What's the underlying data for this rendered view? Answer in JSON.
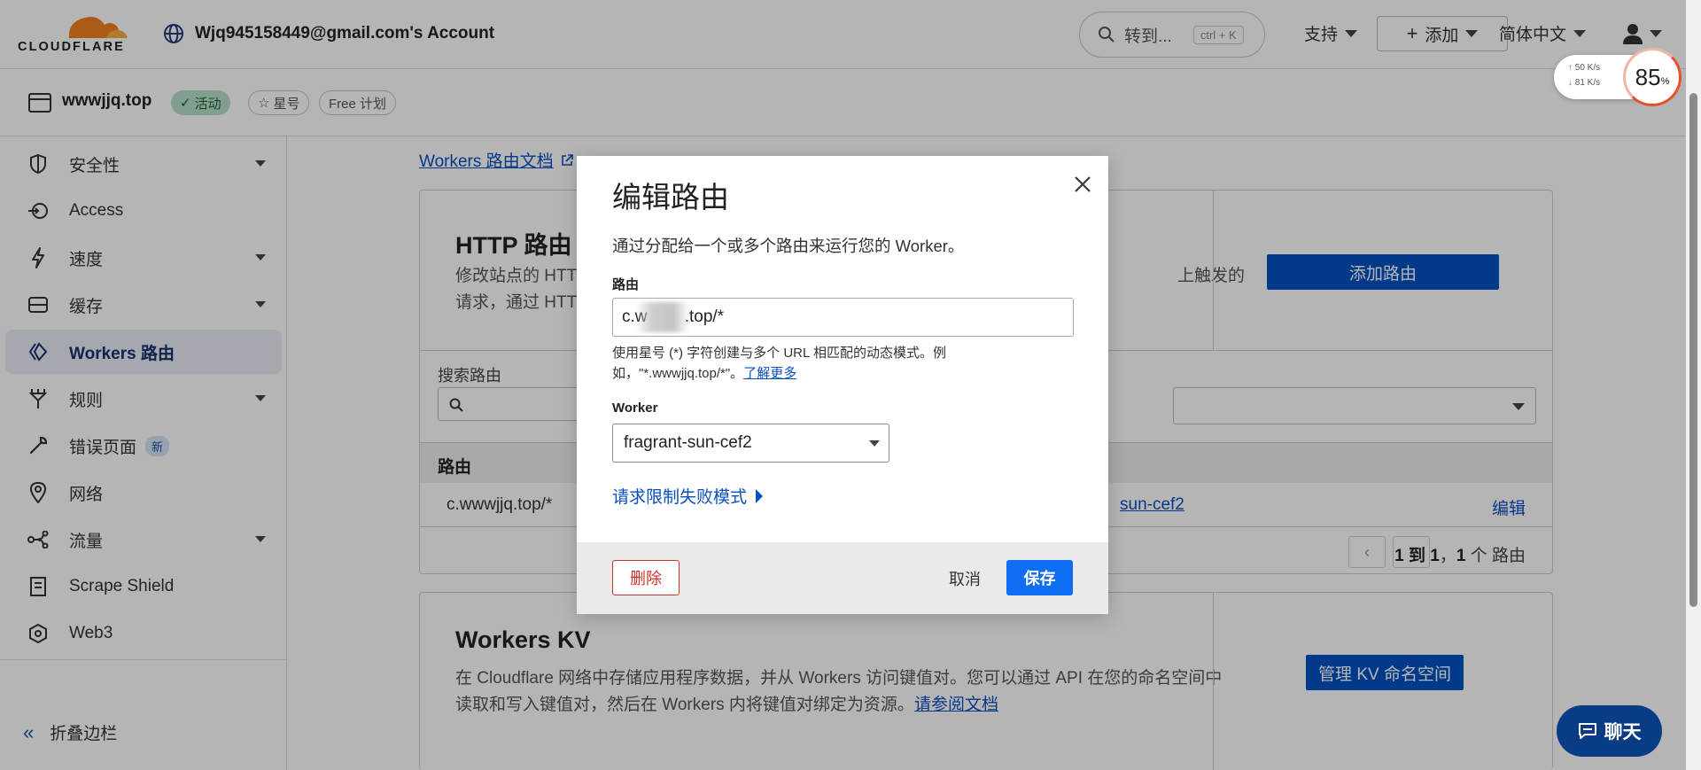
{
  "header": {
    "logo_text": "CLOUDFLARE",
    "account": "Wjq945158449@gmail.com's Account",
    "search_label": "转到...",
    "search_shortcut": "ctrl + K",
    "support": "支持",
    "add": "添加",
    "language": "简体中文"
  },
  "zone": {
    "name": "wwwjjq.top",
    "status": "活动",
    "star": "星号",
    "plan": "Free 计划"
  },
  "sidebar": {
    "items": [
      {
        "label": "安全性",
        "icon": "shield-icon",
        "expandable": true
      },
      {
        "label": "Access",
        "icon": "access-icon",
        "expandable": false
      },
      {
        "label": "速度",
        "icon": "lightning-icon",
        "expandable": true
      },
      {
        "label": "缓存",
        "icon": "cache-icon",
        "expandable": true
      },
      {
        "label": "Workers 路由",
        "icon": "workers-icon",
        "expandable": false,
        "active": true
      },
      {
        "label": "规则",
        "icon": "rules-icon",
        "expandable": true
      },
      {
        "label": "错误页面",
        "icon": "wrench-icon",
        "expandable": false,
        "badge": "新"
      },
      {
        "label": "网络",
        "icon": "location-pin-icon",
        "expandable": false
      },
      {
        "label": "流量",
        "icon": "traffic-icon",
        "expandable": true
      },
      {
        "label": "Scrape Shield",
        "icon": "document-icon",
        "expandable": false
      },
      {
        "label": "Web3",
        "icon": "web3-icon",
        "expandable": false
      }
    ],
    "collapse": "折叠边栏"
  },
  "main": {
    "doc_link": "Workers 路由文档",
    "http": {
      "title": "HTTP 路由",
      "desc_left": "修改站点的 HTT",
      "desc_left2": "请求，通过 HTT",
      "desc_right": "上触发的",
      "add_button": "添加路由",
      "search_label": "搜索路由",
      "column_route": "路由",
      "row_route": "c.wwwjjq.top/*",
      "row_worker": "sun-cef2",
      "row_edit": "编辑",
      "pager_prev": "‹",
      "pager_next": "›",
      "pager_range": "1 到 1",
      "pager_sep": "，",
      "pager_total": "1",
      "pager_unit": " 个 路由"
    },
    "kv": {
      "title": "Workers KV",
      "desc": "在 Cloudflare 网络中存储应用程序数据，并从 Workers 访问键值对。您可以通过 API 在您的命名空间中读取和写入键值对，然后在 Workers 内将键值对绑定为资源。",
      "desc_link": "请参阅文档",
      "button": "管理 KV 命名空间"
    }
  },
  "modal": {
    "title": "编辑路由",
    "description": "通过分配给一个或多个路由来运行您的 Worker。",
    "route_label": "路由",
    "route_value": "c.w        .top/*",
    "route_help": "使用星号 (*) 字符创建与多个 URL 相匹配的动态模式。例如，\"*.wwwjjq.top/*\"。",
    "route_help_link": "了解更多",
    "worker_label": "Worker",
    "worker_value": "fragrant-sun-cef2",
    "ratelimit": "请求限制失败模式",
    "delete": "删除",
    "cancel": "取消",
    "save": "保存"
  },
  "chat": {
    "label": "聊天"
  },
  "netspeed": {
    "up": "50  K/s",
    "down": "81  K/s",
    "percent": "85",
    "percent_unit": "%"
  },
  "colors": {
    "accent": "#0051c3",
    "link": "#0a4ec2",
    "danger": "#d0312d",
    "save": "#0f6df2",
    "logo_orange": "#f38020"
  }
}
